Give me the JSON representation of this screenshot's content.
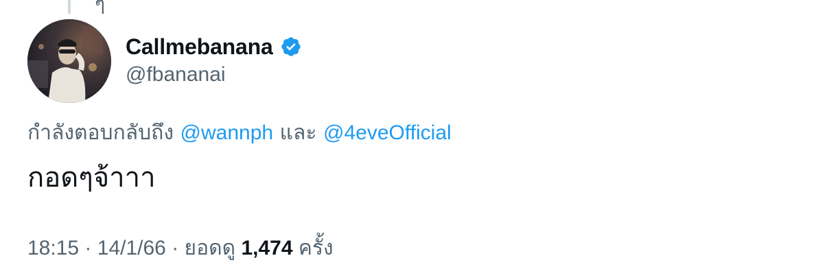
{
  "colors": {
    "text_primary": "#0f1419",
    "text_secondary": "#536471",
    "link": "#1d9bf0",
    "verified": "#1d9bf0"
  },
  "top": {
    "partial_glyph": "ๆ"
  },
  "author": {
    "display_name": "Callmebanana",
    "handle": "@fbananai",
    "verified_icon": "verified-badge-icon"
  },
  "reply": {
    "prefix": "กำลังตอบกลับถึง",
    "mention_1": "@wannph",
    "conjunction": "และ",
    "mention_2": "@4eveOfficial"
  },
  "tweet": {
    "text": "กอดๆจ้าาา"
  },
  "meta": {
    "time": "18:15",
    "separator_1": "·",
    "date": "14/1/66",
    "separator_2": "·",
    "views_label": "ยอดดู",
    "views_count": "1,474",
    "views_unit": "ครั้ง"
  }
}
